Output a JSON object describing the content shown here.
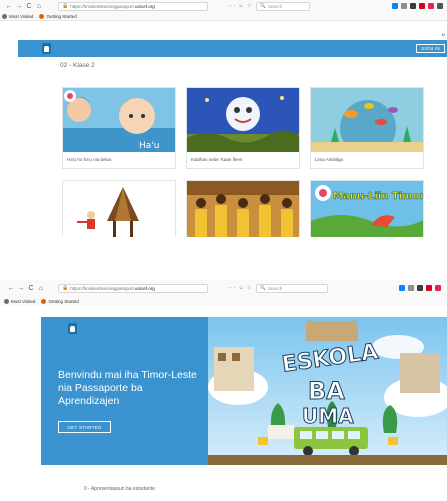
{
  "shot_top": {
    "browser": {
      "nav": [
        "←",
        "→",
        "C",
        "⌂"
      ],
      "url_prefix": "https://hmsilentlearningpassport.",
      "url_domain": "unicef.org",
      "page_actions": "··· ☺ ☆",
      "search_placeholder": "Search"
    },
    "bookmarks": [
      {
        "label": "Most Visited",
        "icon_color": "#6d6d6d"
      },
      {
        "label": "Getting Started",
        "icon_color": "#e66000"
      }
    ],
    "faint_text": "M",
    "header": {
      "logo_icon": "learning-passport-logo-icon",
      "signin_label": "SIGN IN"
    },
    "section_title": "02 - Klase 2",
    "cards": [
      {
        "caption": "Ha'u ho ha'u nia belun",
        "thumb": "children-swimming-illustration"
      },
      {
        "caption": "Kabihan nebe 'Kaan fleen",
        "thumb": "smiling-moon-illustration"
      },
      {
        "caption": "Lima Ambiliga",
        "thumb": "underwater-fish-illustration"
      },
      {
        "caption": "",
        "thumb": "traditional-house-illustration"
      },
      {
        "caption": "",
        "thumb": "school-children-photo"
      },
      {
        "caption": "",
        "thumb": "manu-liin-timor-book-cover",
        "cover_text": "Manu-Liin Timor"
      }
    ],
    "colors": {
      "brand_blue": "#3a93cf"
    }
  },
  "shot_bottom": {
    "browser": {
      "nav": [
        "←",
        "→",
        "C",
        "⌂"
      ],
      "url_prefix": "https://hmsilentlearningpassport.",
      "url_domain": "unicef.org",
      "page_actions": "··· ☺ ☆",
      "search_placeholder": "Search"
    },
    "bookmarks": [
      {
        "label": "Most Visited",
        "icon_color": "#6d6d6d"
      },
      {
        "label": "Getting Started",
        "icon_color": "#e66000"
      }
    ],
    "hero": {
      "title": "Benvindu mai iha Timor-Leste nia Passaporte ba Aprendizajen",
      "cta_label": "GET STARTED",
      "banner_text": [
        "ESKOLA",
        "BA",
        "UMA"
      ]
    },
    "section_title": "0 - Apresentasaun ba estudante"
  }
}
